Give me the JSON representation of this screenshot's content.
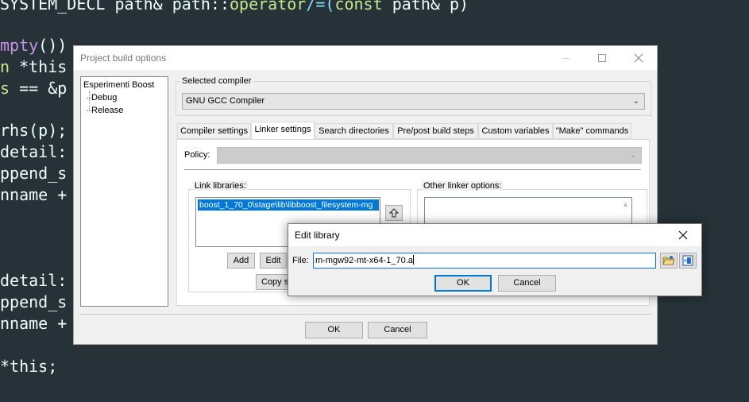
{
  "editor": {
    "lines": [
      {
        "segments": [
          {
            "t": "SYSTEM_DECL path& path::",
            "c": ""
          },
          {
            "t": "operator",
            "c": "kw"
          },
          {
            "t": "/=(",
            "c": "op"
          },
          {
            "t": "const",
            "c": "kw"
          },
          {
            "t": " path& p)",
            "c": ""
          }
        ]
      },
      {
        "segments": [
          {
            "t": "mpty",
            "c": "tp"
          },
          {
            "t": "())",
            "c": ""
          }
        ]
      },
      {
        "segments": [
          {
            "t": "n ",
            "c": "kw"
          },
          {
            "t": "*this",
            "c": ""
          }
        ]
      },
      {
        "segments": [
          {
            "t": "s ",
            "c": "kw"
          },
          {
            "t": "== &p",
            "c": ""
          }
        ]
      },
      {
        "segments": [
          {
            "t": "",
            "c": ""
          }
        ]
      },
      {
        "segments": [
          {
            "t": "rhs(p);",
            "c": ""
          }
        ]
      },
      {
        "segments": [
          {
            "t": "detail:",
            "c": ""
          }
        ]
      },
      {
        "segments": [
          {
            "t": "ppend_s",
            "c": ""
          }
        ]
      },
      {
        "segments": [
          {
            "t": "nname +",
            "c": ""
          }
        ]
      },
      {
        "segments": [
          {
            "t": "",
            "c": ""
          }
        ]
      },
      {
        "segments": [
          {
            "t": "",
            "c": ""
          }
        ]
      },
      {
        "segments": [
          {
            "t": "",
            "c": ""
          }
        ]
      },
      {
        "segments": [
          {
            "t": "detail:",
            "c": ""
          }
        ]
      },
      {
        "segments": [
          {
            "t": "ppend_s",
            "c": ""
          }
        ]
      },
      {
        "segments": [
          {
            "t": "nname +",
            "c": ""
          }
        ]
      },
      {
        "segments": [
          {
            "t": "",
            "c": ""
          }
        ]
      },
      {
        "segments": [
          {
            "t": "*this",
            "c": ""
          },
          {
            "t": ";",
            "c": ""
          }
        ]
      }
    ]
  },
  "build_options": {
    "title": "Project build options",
    "tree": {
      "root": "Esperimenti Boost",
      "children": [
        "Debug",
        "Release"
      ]
    },
    "selected_compiler_label": "Selected compiler",
    "compiler_value": "GNU GCC Compiler",
    "tabs": [
      {
        "label": "Compiler settings"
      },
      {
        "label": "Linker settings",
        "active": true
      },
      {
        "label": "Search directories"
      },
      {
        "label": "Pre/post build steps"
      },
      {
        "label": "Custom variables"
      },
      {
        "label": "\"Make\" commands"
      }
    ],
    "policy_label": "Policy:",
    "policy_value": "",
    "link_libraries_label": "Link libraries:",
    "link_libraries": [
      "boost_1_70_0\\stage\\lib\\libboost_filesystem-mg"
    ],
    "other_linker_label": "Other linker options:",
    "buttons": {
      "add": "Add",
      "edit": "Edit",
      "copy": "Copy s",
      "ok": "OK",
      "cancel": "Cancel"
    }
  },
  "edit_library": {
    "title": "Edit library",
    "file_label": "File:",
    "file_value": "m-mgw92-mt-x64-1_70.a",
    "ok": "OK",
    "cancel": "Cancel"
  },
  "icons": {
    "close": "close-icon",
    "maximize": "maximize-icon",
    "minimize": "minimize-icon",
    "move_up": "arrow-up-icon",
    "browse": "open-folder-icon",
    "other": "variable-icon"
  }
}
